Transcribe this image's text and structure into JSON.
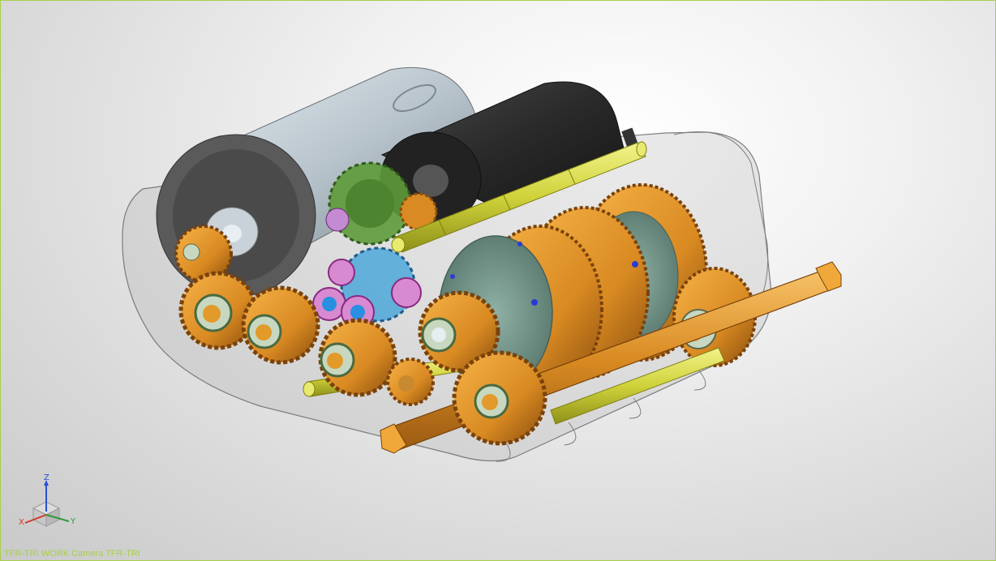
{
  "viewport": {
    "status_text": "TFR-TRI WORK Camera TFR-TRI"
  },
  "triad": {
    "x_label": "X",
    "y_label": "Y",
    "z_label": "Z",
    "x_color": "#d23a2a",
    "y_color": "#2f9a3a",
    "z_color": "#2a4fd2"
  },
  "colors": {
    "gear_orange": "#d98a22",
    "shaft_yellow": "#cfd23a",
    "gear_green": "#5e9a3a",
    "gear_blue": "#3aa0d8",
    "bearing_magenta": "#b04aa8",
    "motor_silver": "#b8c4cc",
    "motor_black": "#2a2a2a",
    "accent_border": "#a9cf4a"
  }
}
